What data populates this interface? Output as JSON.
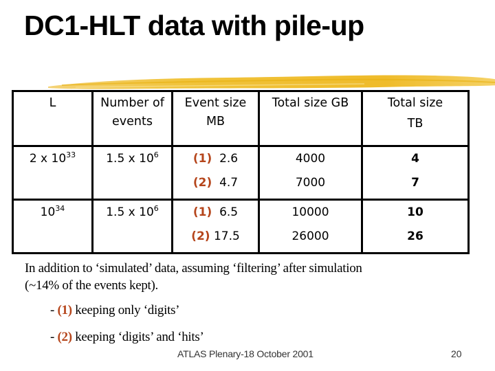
{
  "slide": {
    "title": "DC1-HLT data with pile-up",
    "accent_color": "#b5451b",
    "brush_color": "#f0c030"
  },
  "table": {
    "headers": [
      {
        "line1": "L",
        "line2": ""
      },
      {
        "line1": "Number of",
        "line2": "events"
      },
      {
        "line1": "Event size",
        "line2": "MB"
      },
      {
        "line1": "Total size GB",
        "line2": ""
      },
      {
        "line1": "Total size",
        "line2": "TB"
      }
    ],
    "rows": [
      {
        "luminosity_base": "2 x 10",
        "luminosity_exp": "33",
        "events_base": "1.5 x 10",
        "events_exp": "6",
        "event_size": [
          {
            "tag": "(1)",
            "value": "2.6"
          },
          {
            "tag": "(2)",
            "value": "4.7"
          }
        ],
        "total_gb": [
          "4000",
          "7000"
        ],
        "total_tb": [
          "4",
          "7"
        ]
      },
      {
        "luminosity_base": "10",
        "luminosity_exp": "34",
        "events_base": "1.5 x 10",
        "events_exp": "6",
        "event_size": [
          {
            "tag": "(1)",
            "value": "6.5"
          },
          {
            "tag": "(2)",
            "value": "17.5"
          }
        ],
        "total_gb": [
          "10000",
          "26000"
        ],
        "total_tb": [
          "10",
          "26"
        ]
      }
    ]
  },
  "body": {
    "paragraph_line1": "In addition to  ‘simulated’ data, assuming ‘filtering’ after simulation",
    "paragraph_line2": "(~14% of the events kept).",
    "bullets": [
      {
        "dash": "- ",
        "tag": "(1)",
        "text": " keeping only ‘digits’"
      },
      {
        "dash": "- ",
        "tag": "(2)",
        "text": " keeping ‘digits’ and ‘hits’"
      }
    ]
  },
  "footer": {
    "text": "ATLAS Plenary-18 October 2001",
    "page_number": "20"
  }
}
